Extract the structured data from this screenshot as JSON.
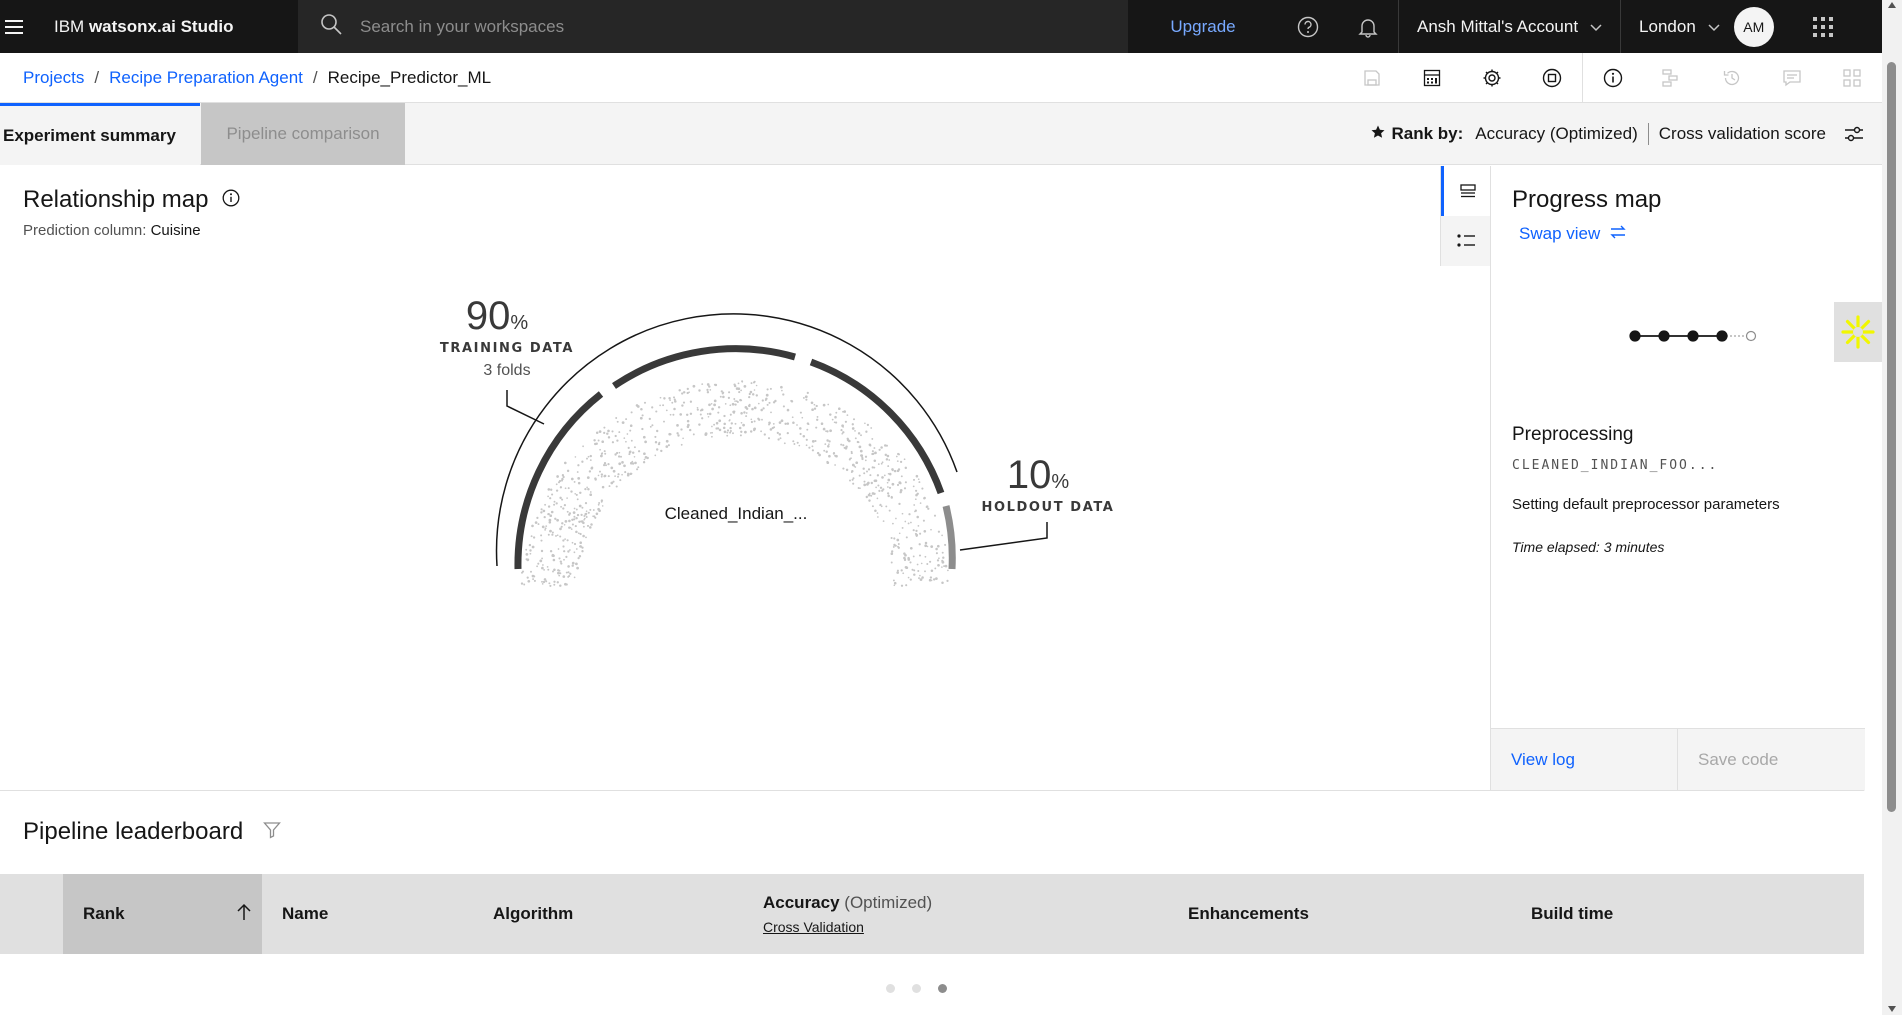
{
  "header": {
    "brand_prefix": "IBM ",
    "brand_name": "watsonx.ai Studio",
    "search_placeholder": "Search in your workspaces",
    "upgrade": "Upgrade",
    "account": "Ansh Mittal's Account",
    "region": "London",
    "avatar_initials": "AM"
  },
  "breadcrumb": [
    "Projects",
    "Recipe Preparation Agent",
    "Recipe_Predictor_ML"
  ],
  "tabs": {
    "experiment_summary": "Experiment summary",
    "pipeline_comparison": "Pipeline comparison"
  },
  "rank_by": {
    "label": "Rank by:",
    "metric": "Accuracy (Optimized)",
    "score": "Cross validation score"
  },
  "relationship_map": {
    "title": "Relationship map",
    "prediction_label": "Prediction column:",
    "prediction_value": "Cuisine",
    "training_pct": "90",
    "training_label": "TRAINING DATA",
    "training_folds": "3 folds",
    "holdout_pct": "10",
    "holdout_label": "HOLDOUT DATA",
    "pct_sign": "%",
    "dataset": "Cleaned_Indian_..."
  },
  "progress_map": {
    "title": "Progress map",
    "swap_view": "Swap view",
    "stage": "Preprocessing",
    "file": "CLEANED_INDIAN_FOO...",
    "message": "Setting default preprocessor parameters",
    "elapsed": "Time elapsed: 3 minutes",
    "view_log": "View log",
    "save_code": "Save code",
    "steps_completed": 4,
    "steps_total": 5
  },
  "leaderboard": {
    "title": "Pipeline leaderboard",
    "columns": {
      "rank": "Rank",
      "name": "Name",
      "algorithm": "Algorithm",
      "accuracy": "Accuracy",
      "accuracy_opt": "(Optimized)",
      "accuracy_sub": "Cross Validation",
      "enhancements": "Enhancements",
      "build_time": "Build time"
    }
  },
  "pagination": {
    "active_index": 2,
    "count": 3
  },
  "colors": {
    "accent": "#0f62fe",
    "header_bg": "#161616",
    "assistant": "#f1f700"
  },
  "icons": [
    "menu-icon",
    "search-icon",
    "help-icon",
    "notification-icon",
    "chevron-down-icon",
    "app-switcher-icon",
    "save-icon",
    "calculator-icon",
    "settings-icon",
    "stop-icon",
    "info-icon",
    "pipeline-icon",
    "history-icon",
    "comment-icon",
    "layout-icon",
    "star-icon",
    "adjust-icon",
    "list-view-icon",
    "bullet-list-icon",
    "swap-icon",
    "filter-icon",
    "arrow-up-icon",
    "assistant-icon"
  ]
}
